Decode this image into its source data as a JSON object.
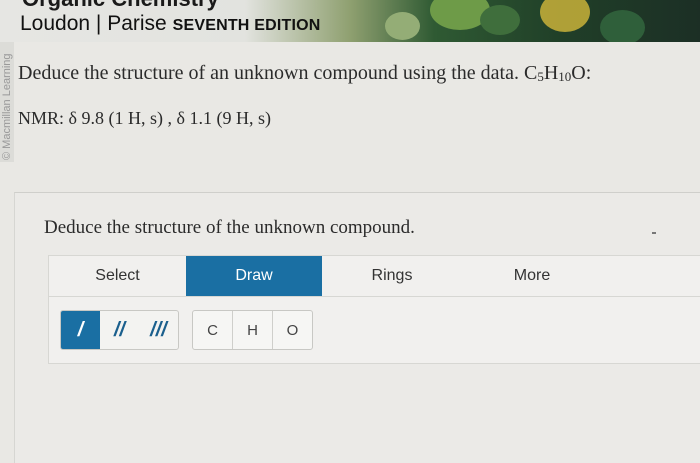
{
  "banner": {
    "title_partial": "Organic Chemistry",
    "authors": "Loudon | Parise",
    "edition": "SEVENTH EDITION"
  },
  "watermark": "© Macmillan Learning",
  "question": {
    "text": "Deduce the structure of an unknown compound using the data. ",
    "formula": {
      "C": "C",
      "c_sub": "5",
      "H": "H",
      "h_sub": "10",
      "O": "O:"
    },
    "nmr": "NMR: δ 9.8  (1 H, s) , δ 1.1  (9 H, s)"
  },
  "prompt": "Deduce the structure of the unknown compound.",
  "tabs": [
    {
      "label": "Select",
      "active": false
    },
    {
      "label": "Draw",
      "active": true
    },
    {
      "label": "Rings",
      "active": false
    },
    {
      "label": "More",
      "active": false
    }
  ],
  "bonds": [
    {
      "label": "/",
      "name": "single-bond",
      "active": true
    },
    {
      "label": "//",
      "name": "double-bond",
      "active": false
    },
    {
      "label": "///",
      "name": "triple-bond",
      "active": false
    }
  ],
  "atoms": [
    "C",
    "H",
    "O"
  ],
  "colors": {
    "accent": "#1a6fa3",
    "text": "#2b2b2b",
    "background": "#e9e8e4"
  }
}
